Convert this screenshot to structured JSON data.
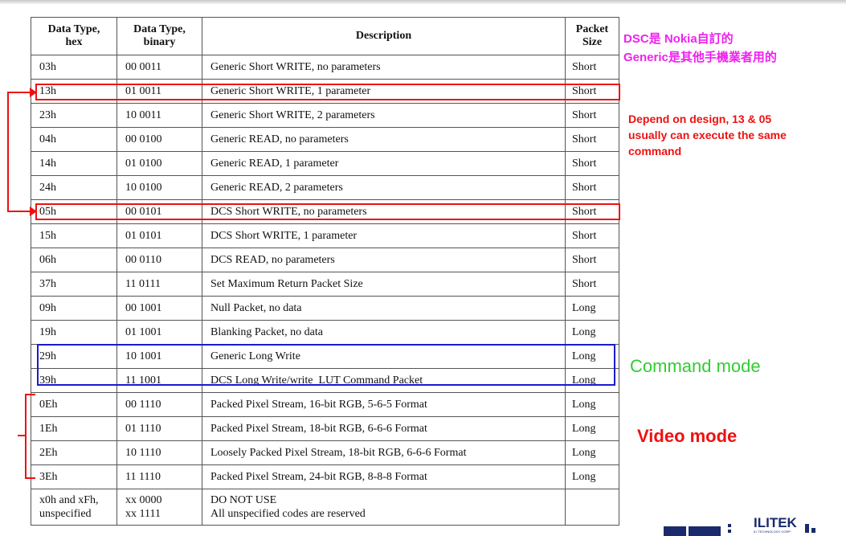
{
  "table": {
    "headers": {
      "hex": [
        "Data Type,",
        "hex"
      ],
      "binary": [
        "Data Type,",
        "binary"
      ],
      "description": "Description",
      "size": [
        "Packet",
        "Size"
      ]
    },
    "rows": [
      {
        "hex": "03h",
        "binary": "00 0011",
        "description": "Generic Short WRITE, no parameters",
        "size": "Short"
      },
      {
        "hex": "13h",
        "binary": "01 0011",
        "description": "Generic Short WRITE, 1 parameter",
        "size": "Short"
      },
      {
        "hex": "23h",
        "binary": "10 0011",
        "description": "Generic Short WRITE, 2 parameters",
        "size": "Short"
      },
      {
        "hex": "04h",
        "binary": "00 0100",
        "description": "Generic READ, no parameters",
        "size": "Short"
      },
      {
        "hex": "14h",
        "binary": "01 0100",
        "description": "Generic READ, 1 parameter",
        "size": "Short"
      },
      {
        "hex": "24h",
        "binary": "10 0100",
        "description": "Generic READ, 2 parameters",
        "size": "Short"
      },
      {
        "hex": "05h",
        "binary": "00 0101",
        "description": "DCS Short WRITE, no parameters",
        "size": "Short"
      },
      {
        "hex": "15h",
        "binary": "01 0101",
        "description": "DCS Short WRITE, 1 parameter",
        "size": "Short"
      },
      {
        "hex": "06h",
        "binary": "00 0110",
        "description": "DCS READ, no parameters",
        "size": "Short"
      },
      {
        "hex": "37h",
        "binary": "11 0111",
        "description": "Set Maximum Return Packet Size",
        "size": "Short"
      },
      {
        "hex": "09h",
        "binary": "00 1001",
        "description": "Null Packet, no data",
        "size": "Long"
      },
      {
        "hex": "19h",
        "binary": "01 1001",
        "description": "Blanking Packet, no data",
        "size": "Long"
      },
      {
        "hex": "29h",
        "binary": "10 1001",
        "description": "Generic Long Write",
        "size": "Long"
      },
      {
        "hex": "39h",
        "binary": "11 1001",
        "description": "DCS Long Write/write_LUT Command Packet",
        "size": "Long"
      },
      {
        "hex": "0Eh",
        "binary": "00 1110",
        "description": "Packed Pixel Stream, 16-bit RGB, 5-6-5 Format",
        "size": "Long"
      },
      {
        "hex": "1Eh",
        "binary": "01 1110",
        "description": "Packed Pixel Stream, 18-bit RGB, 6-6-6 Format",
        "size": "Long"
      },
      {
        "hex": "2Eh",
        "binary": "10 1110",
        "description": "Loosely Packed Pixel Stream, 18-bit RGB, 6-6-6 Format",
        "size": "Long"
      },
      {
        "hex": "3Eh",
        "binary": "11 1110",
        "description": "Packed Pixel Stream, 24-bit RGB, 8-8-8 Format",
        "size": "Long"
      }
    ],
    "last_row": {
      "hex": [
        "x0h and xFh,",
        "unspecified"
      ],
      "binary": [
        "xx 0000",
        "xx 1111"
      ],
      "description": [
        "DO NOT USE",
        "All unspecified codes are reserved"
      ],
      "size": ""
    }
  },
  "annotations": {
    "dsc_note": [
      "DSC是 Nokia自訂的",
      "Generic是其他手機業者用的"
    ],
    "design_note": [
      "Depend on design, 13 & 05",
      "usually can execute the same",
      "command"
    ],
    "command_mode": "Command mode",
    "video_mode": "Video mode"
  },
  "logo": {
    "text": "ILITEK",
    "subtext": "ILI TECHNOLOGY CORP."
  },
  "colors": {
    "red": "#ee1111",
    "blue": "#1a1acc",
    "magenta": "#ee22ee",
    "green": "#33cc33",
    "note_red": "#ee1111"
  }
}
